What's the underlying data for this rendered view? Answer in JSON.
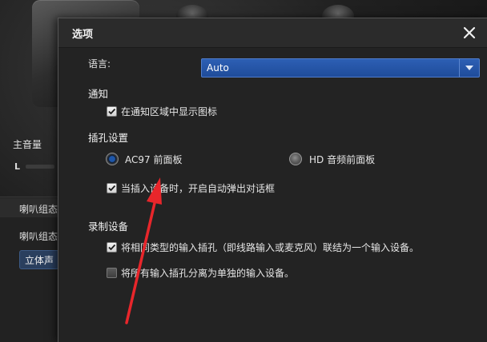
{
  "background_app": {
    "master_volume_label": "主音量",
    "channel_left_label": "L",
    "speaker_panel_title": "喇叭组态",
    "speaker_config_label": "喇叭组态",
    "speaker_config_value": "立体声"
  },
  "dialog": {
    "title": "选项",
    "language": {
      "label": "语言:",
      "value": "Auto"
    },
    "notifications": {
      "section_title": "通知",
      "show_icon": {
        "label": "在通知区域中显示图标",
        "checked": true
      }
    },
    "jack_settings": {
      "section_title": "插孔设置",
      "options": [
        {
          "label": "AC97 前面板",
          "selected": true
        },
        {
          "label": "HD 音频前面板",
          "selected": false
        }
      ],
      "auto_popup": {
        "label": "当插入设备时，开启自动弹出对话框",
        "checked": true
      }
    },
    "recording": {
      "section_title": "录制设备",
      "combine_inputs": {
        "label": "将相同类型的输入插孔（即线路输入或麦克风）联结为一个输入设备。",
        "checked": true
      },
      "separate_inputs": {
        "label": "将所有输入插孔分离为单独的输入设备。",
        "checked": false
      }
    }
  },
  "colors": {
    "accent": "#2356a8",
    "annotation_arrow": "#e8262b",
    "dialog_background": "#232323"
  },
  "icons": {
    "close": "close-icon",
    "dropdown": "chevron-down-icon",
    "check": "checkmark-icon"
  }
}
